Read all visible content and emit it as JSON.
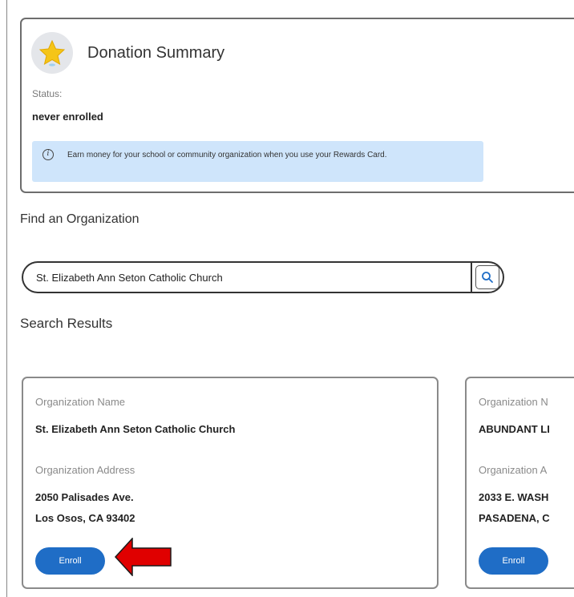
{
  "donation_summary": {
    "title": "Donation Summary",
    "status_label": "Status:",
    "status_value": "never enrolled",
    "info_text": "Earn money for your school or community organization when you use your Rewards Card."
  },
  "find": {
    "heading": "Find an Organization",
    "search_value": "St. Elizabeth Ann Seton Catholic Church"
  },
  "results": {
    "heading": "Search Results",
    "cards": [
      {
        "name_label": "Organization Name",
        "name": "St. Elizabeth Ann Seton Catholic Church",
        "address_label": "Organization Address",
        "address_line1": "2050 Palisades Ave.",
        "address_line2": "Los Osos, CA 93402",
        "enroll_label": "Enroll"
      },
      {
        "name_label": "Organization N",
        "name": "ABUNDANT LI",
        "address_label": "Organization A",
        "address_line1": "2033 E. WASH",
        "address_line2": "PASADENA, C",
        "enroll_label": "Enroll"
      }
    ]
  },
  "icons": {
    "summary": "star-icon",
    "info": "info-icon",
    "search": "search-icon",
    "annotation": "red-arrow-icon"
  },
  "colors": {
    "accent": "#1f6dc6",
    "info_bg": "#cfe5fb",
    "star": "#f5c518",
    "arrow": "#e00000"
  }
}
